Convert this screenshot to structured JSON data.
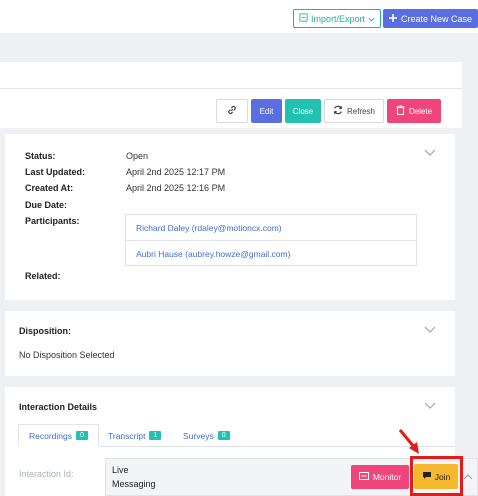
{
  "header": {
    "import_export_label": "Import/Export",
    "create_case_label": "Create New Case"
  },
  "actions": {
    "edit": "Edit",
    "close": "Close",
    "refresh": "Refresh",
    "delete": "Delete"
  },
  "details": {
    "status_label": "Status:",
    "status_value": "Open",
    "last_updated_label": "Last Updated:",
    "last_updated_value": "April 2nd 2025 12:17 PM",
    "created_at_label": "Created At:",
    "created_at_value": "April 2nd 2025 12:16 PM",
    "due_date_label": "Due Date:",
    "participants_label": "Participants:",
    "participants": [
      "Richard Daley (rdaley@motioncx.com)",
      "Aubri Hause (aubrey.howze@gmail.com)"
    ],
    "related_label": "Related:"
  },
  "disposition": {
    "title": "Disposition:",
    "value": "No Disposition Selected"
  },
  "interaction_details": {
    "title": "Interaction Details",
    "tabs": [
      {
        "label": "Recordings",
        "count": "0"
      },
      {
        "label": "Transcript",
        "count": "1"
      },
      {
        "label": "Surveys",
        "count": "0"
      }
    ],
    "interaction_id_label": "Interaction Id:",
    "status_line1": "Live",
    "status_line2": "Messaging",
    "monitor_label": "Monitor",
    "join_label": "Join"
  },
  "colors": {
    "accent_blue": "#5b6ee1",
    "teal": "#22c2b3",
    "pink": "#f0457a",
    "join_yellow": "#f5b82e",
    "highlight_red": "#e21b1b"
  }
}
